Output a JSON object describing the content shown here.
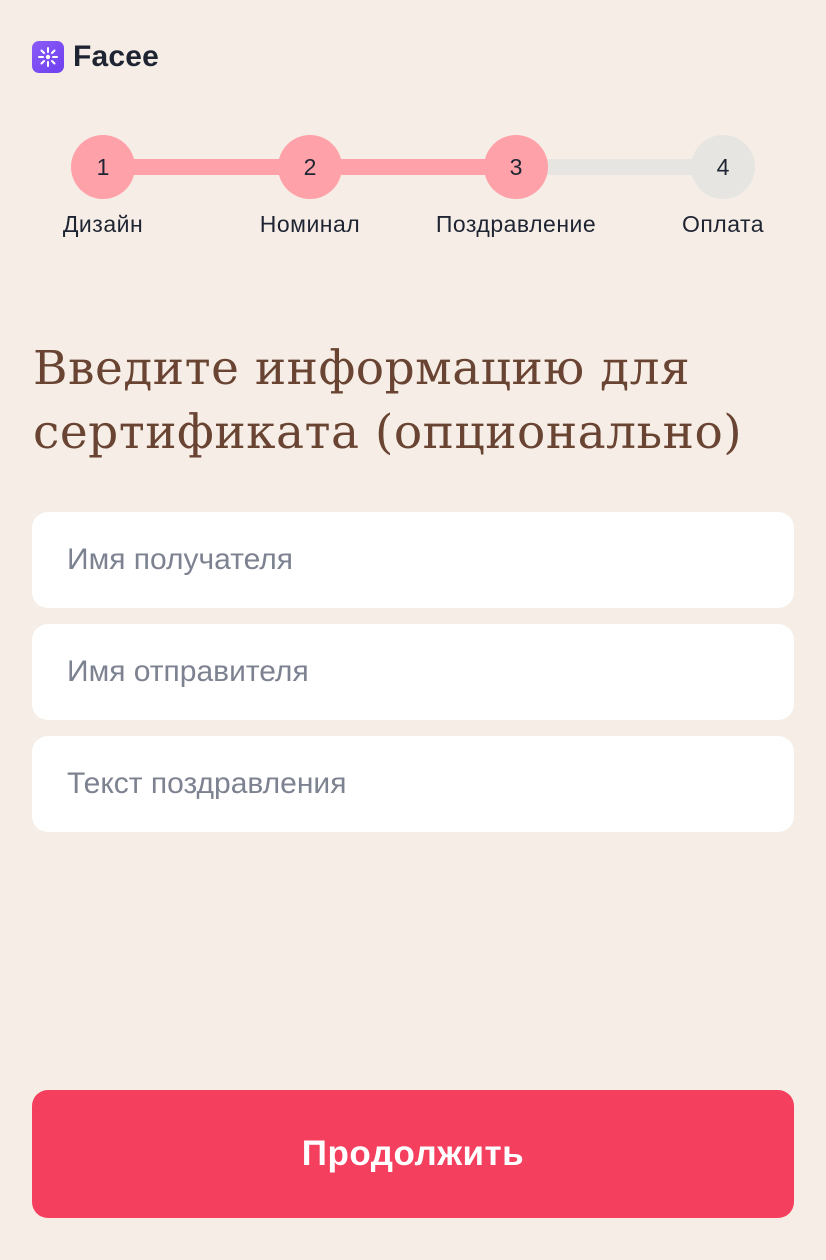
{
  "brand": {
    "name": "Facee",
    "logo_icon": "sparkle-icon",
    "logo_color": "#7c4dff"
  },
  "stepper": {
    "steps": [
      {
        "number": "1",
        "label": "Дизайн",
        "state": "done"
      },
      {
        "number": "2",
        "label": "Номинал",
        "state": "done"
      },
      {
        "number": "3",
        "label": "Поздравление",
        "state": "current"
      },
      {
        "number": "4",
        "label": "Оплата",
        "state": "todo"
      }
    ],
    "active_color": "#ffa1a8",
    "inactive_color": "#e6e5e2"
  },
  "form": {
    "title": "Введите информацию для сертификата (опционально)",
    "recipient_placeholder": "Имя получателя",
    "sender_placeholder": "Имя отправителя",
    "message_placeholder": "Текст поздравления",
    "recipient_value": "",
    "sender_value": "",
    "message_value": ""
  },
  "actions": {
    "continue_label": "Продолжить",
    "continue_color": "#f43f5e"
  },
  "colors": {
    "background": "#f6eee6",
    "title": "#6a4433"
  }
}
